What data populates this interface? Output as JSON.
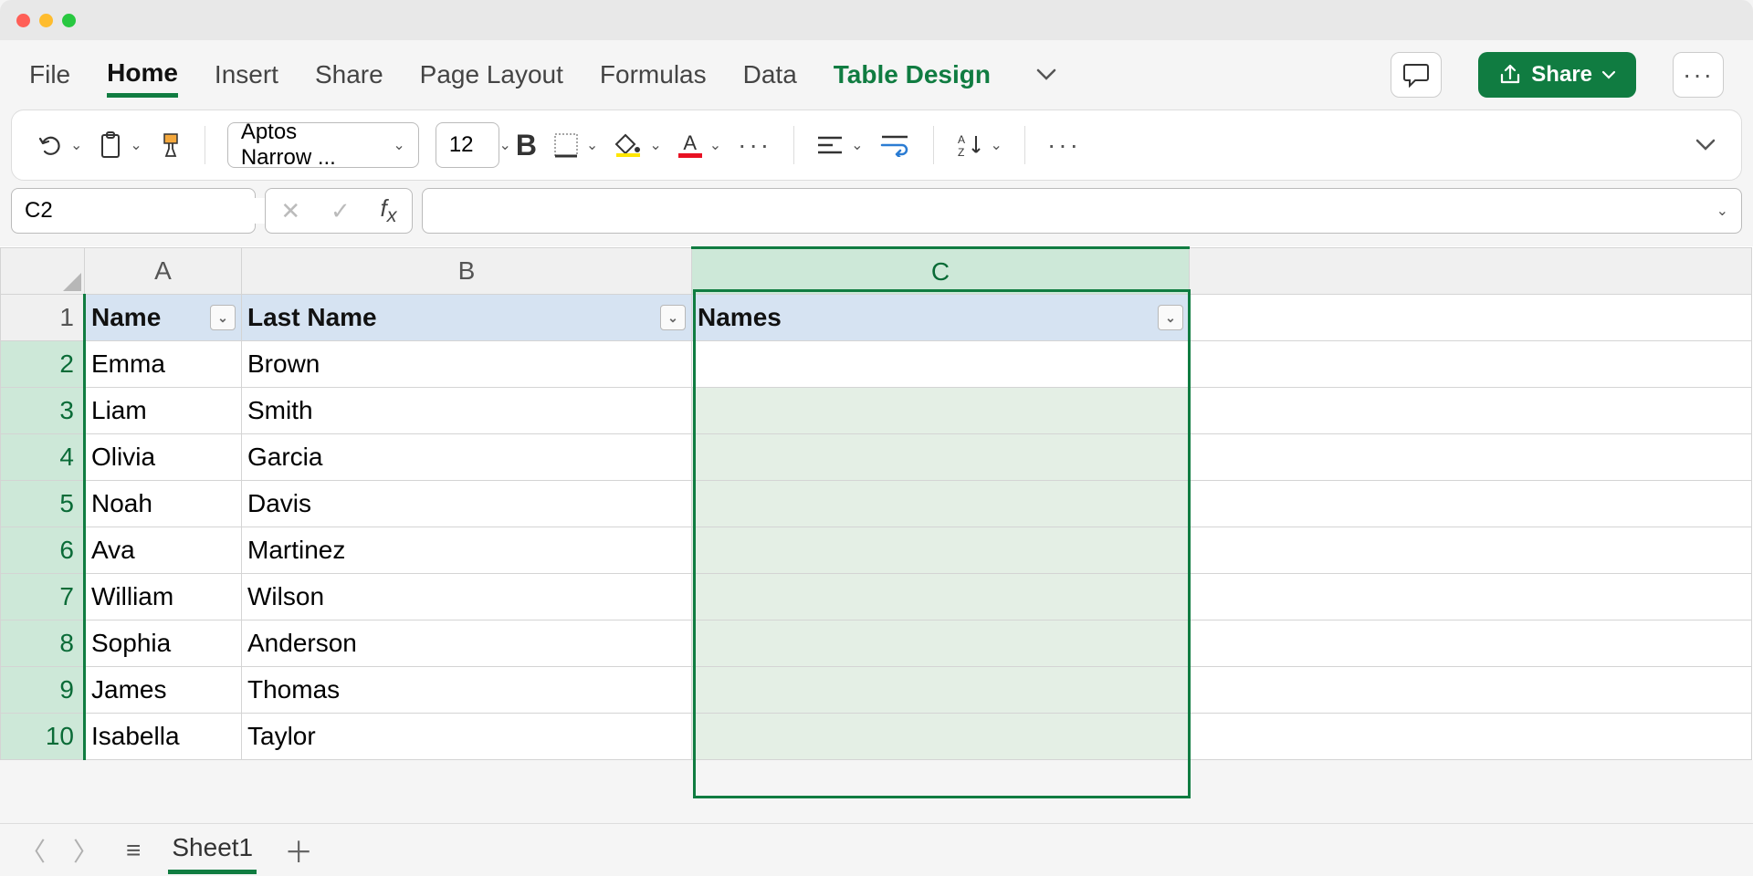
{
  "tabs": {
    "file": "File",
    "home": "Home",
    "insert": "Insert",
    "share": "Share",
    "pagelayout": "Page Layout",
    "formulas": "Formulas",
    "data": "Data",
    "tabledesign": "Table Design"
  },
  "sharebtn": "Share",
  "ribbon": {
    "font_name": "Aptos Narrow ...",
    "font_size": "12",
    "bold": "B"
  },
  "namebox": "C2",
  "formula": "",
  "columns": {
    "A": "A",
    "B": "B",
    "C": "C"
  },
  "rows": [
    "1",
    "2",
    "3",
    "4",
    "5",
    "6",
    "7",
    "8",
    "9",
    "10"
  ],
  "headers": {
    "A": "Name",
    "B": "Last Name",
    "C": "Names"
  },
  "data": [
    {
      "A": "Emma",
      "B": "Brown"
    },
    {
      "A": "Liam",
      "B": "Smith"
    },
    {
      "A": "Olivia",
      "B": "Garcia"
    },
    {
      "A": "Noah",
      "B": "Davis"
    },
    {
      "A": "Ava",
      "B": "Martinez"
    },
    {
      "A": "William",
      "B": "Wilson"
    },
    {
      "A": "Sophia",
      "B": "Anderson"
    },
    {
      "A": "James",
      "B": "Thomas"
    },
    {
      "A": "Isabella",
      "B": "Taylor"
    }
  ],
  "sheet": "Sheet1"
}
